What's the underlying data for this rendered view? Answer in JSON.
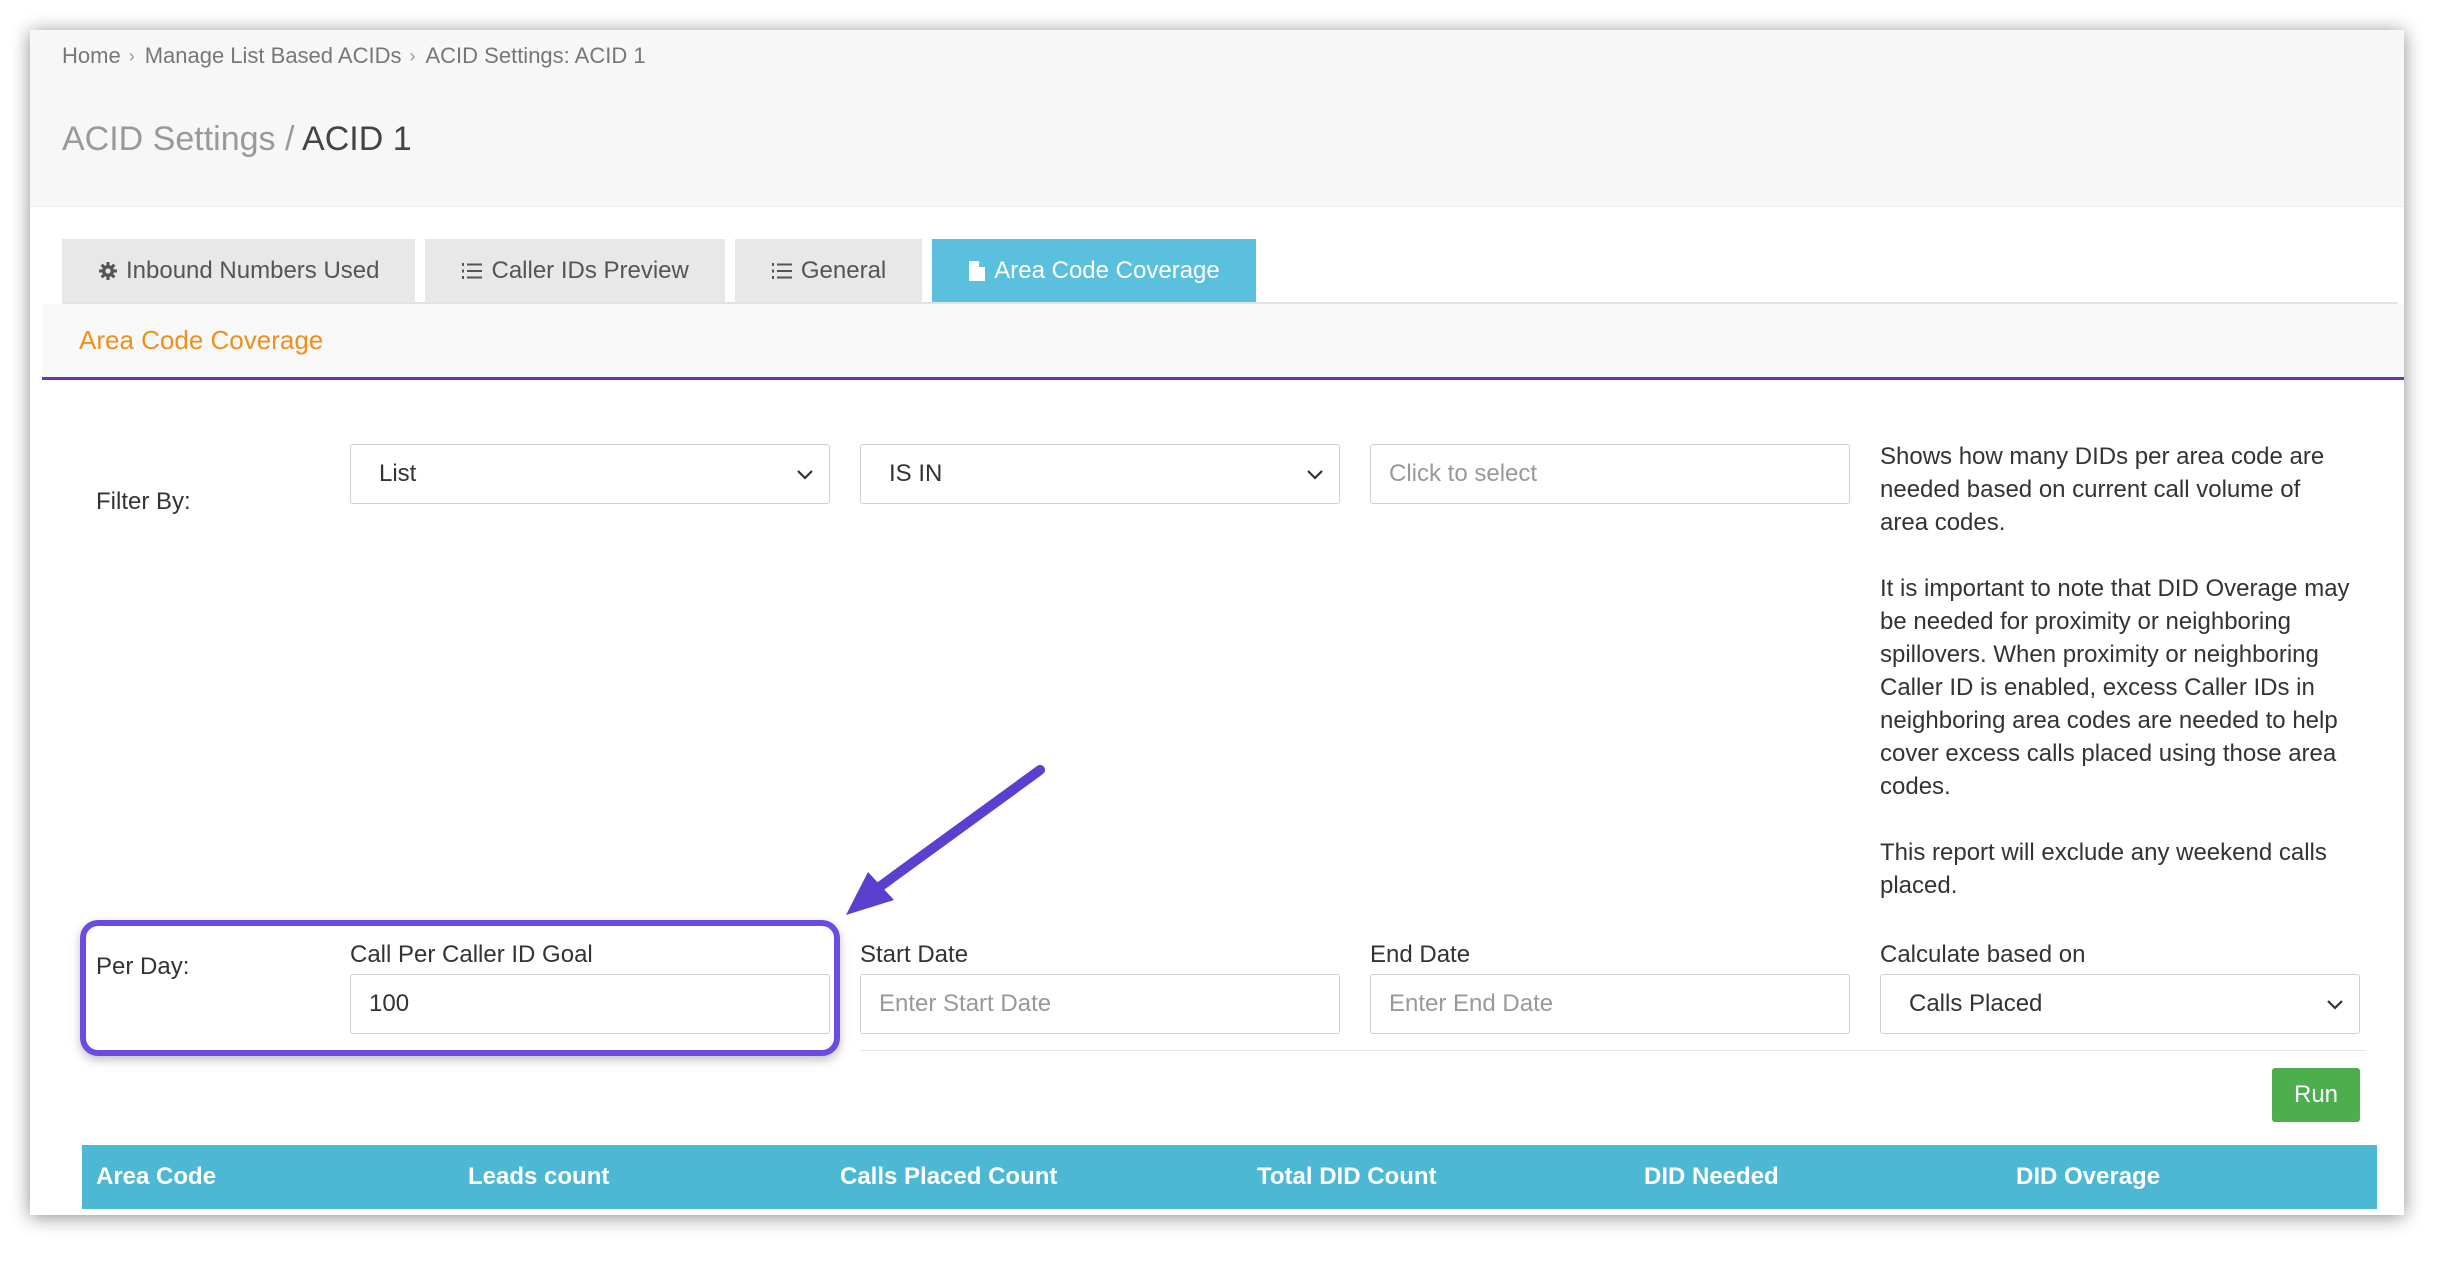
{
  "breadcrumb": [
    "Home",
    "Manage List Based ACIDs",
    "ACID Settings: ACID 1"
  ],
  "page_title": {
    "muted": "ACID Settings",
    "separator": "/",
    "strong": "ACID 1"
  },
  "tabs": [
    {
      "label": "Inbound Numbers Used",
      "icon": "gear-icon",
      "active": false
    },
    {
      "label": "Caller IDs Preview",
      "icon": "list-ordered-icon",
      "active": false
    },
    {
      "label": "General",
      "icon": "list-ordered-icon",
      "active": false
    },
    {
      "label": "Area Code Coverage",
      "icon": "file-icon",
      "active": true
    }
  ],
  "panel_title": "Area Code Coverage",
  "filter": {
    "label": "Filter By:",
    "field_value": "List",
    "operator_value": "IS IN",
    "target_placeholder": "Click to select"
  },
  "info": {
    "p1": "Shows how many DIDs per area code are needed based on current call volume of area codes.",
    "p2": "It is important to note that DID Overage may be needed for proximity or neighboring spillovers. When proximity or neighboring Caller ID is enabled, excess Caller IDs in neighboring area codes are needed to help cover excess calls placed using those area codes.",
    "p3": "This report will exclude any weekend calls placed."
  },
  "per_day": {
    "label": "Per Day:",
    "goal_label": "Call Per Caller ID Goal",
    "goal_value": "100",
    "start_label": "Start Date",
    "start_placeholder": "Enter Start Date",
    "end_label": "End Date",
    "end_placeholder": "Enter End Date",
    "calc_label": "Calculate based on",
    "calc_value": "Calls Placed"
  },
  "run_label": "Run",
  "table": {
    "columns": [
      "Area Code",
      "Leads count",
      "Calls Placed Count",
      "Total DID Count",
      "DID Needed",
      "DID Overage"
    ]
  },
  "colors": {
    "tab_active": "#5bc0de",
    "panel_title": "#f0901a",
    "panel_rule": "#6a33b8",
    "run_button": "#4cae4c",
    "table_header": "#4db8d4",
    "annotation": "#6a4de0"
  }
}
